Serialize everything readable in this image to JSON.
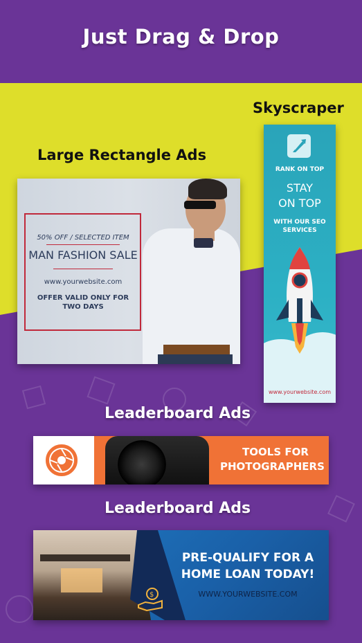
{
  "header": {
    "title": "Just Drag & Drop"
  },
  "sections": {
    "skyscraper": "Skyscraper",
    "large_rectangle": "Large Rectangle Ads",
    "leaderboard_1": "Leaderboard Ads",
    "leaderboard_2": "Leaderboard Ads"
  },
  "rect_ad": {
    "offer": "50% OFF / SELECTED ITEM",
    "headline": "MAN FASHION SALE",
    "website": "www.yourwebsite.com",
    "note_line1": "OFFER VALID ONLY FOR",
    "note_line2": "TWO DAYS"
  },
  "sky_ad": {
    "kicker": "RANK ON TOP",
    "headline_line1": "STAY",
    "headline_line2": "ON TOP",
    "sub_line1": "WITH OUR SEO",
    "sub_line2": "SERVICES",
    "website": "www.yourwebsite.com"
  },
  "leaderboard_photo": {
    "line1": "TOOLS FOR",
    "line2": "PHOTOGRAPHERS"
  },
  "leaderboard_loan": {
    "line1": "PRE-QUALIFY FOR A",
    "line2": "HOME LOAN TODAY!",
    "website": "WWW.YOURWEBSITE.COM"
  },
  "colors": {
    "background": "#6a3497",
    "band": "#dede2a",
    "accent_red": "#c0283a",
    "sky_teal": "#2aa4b9",
    "orange": "#f07236",
    "blue": "#1a60a8"
  }
}
